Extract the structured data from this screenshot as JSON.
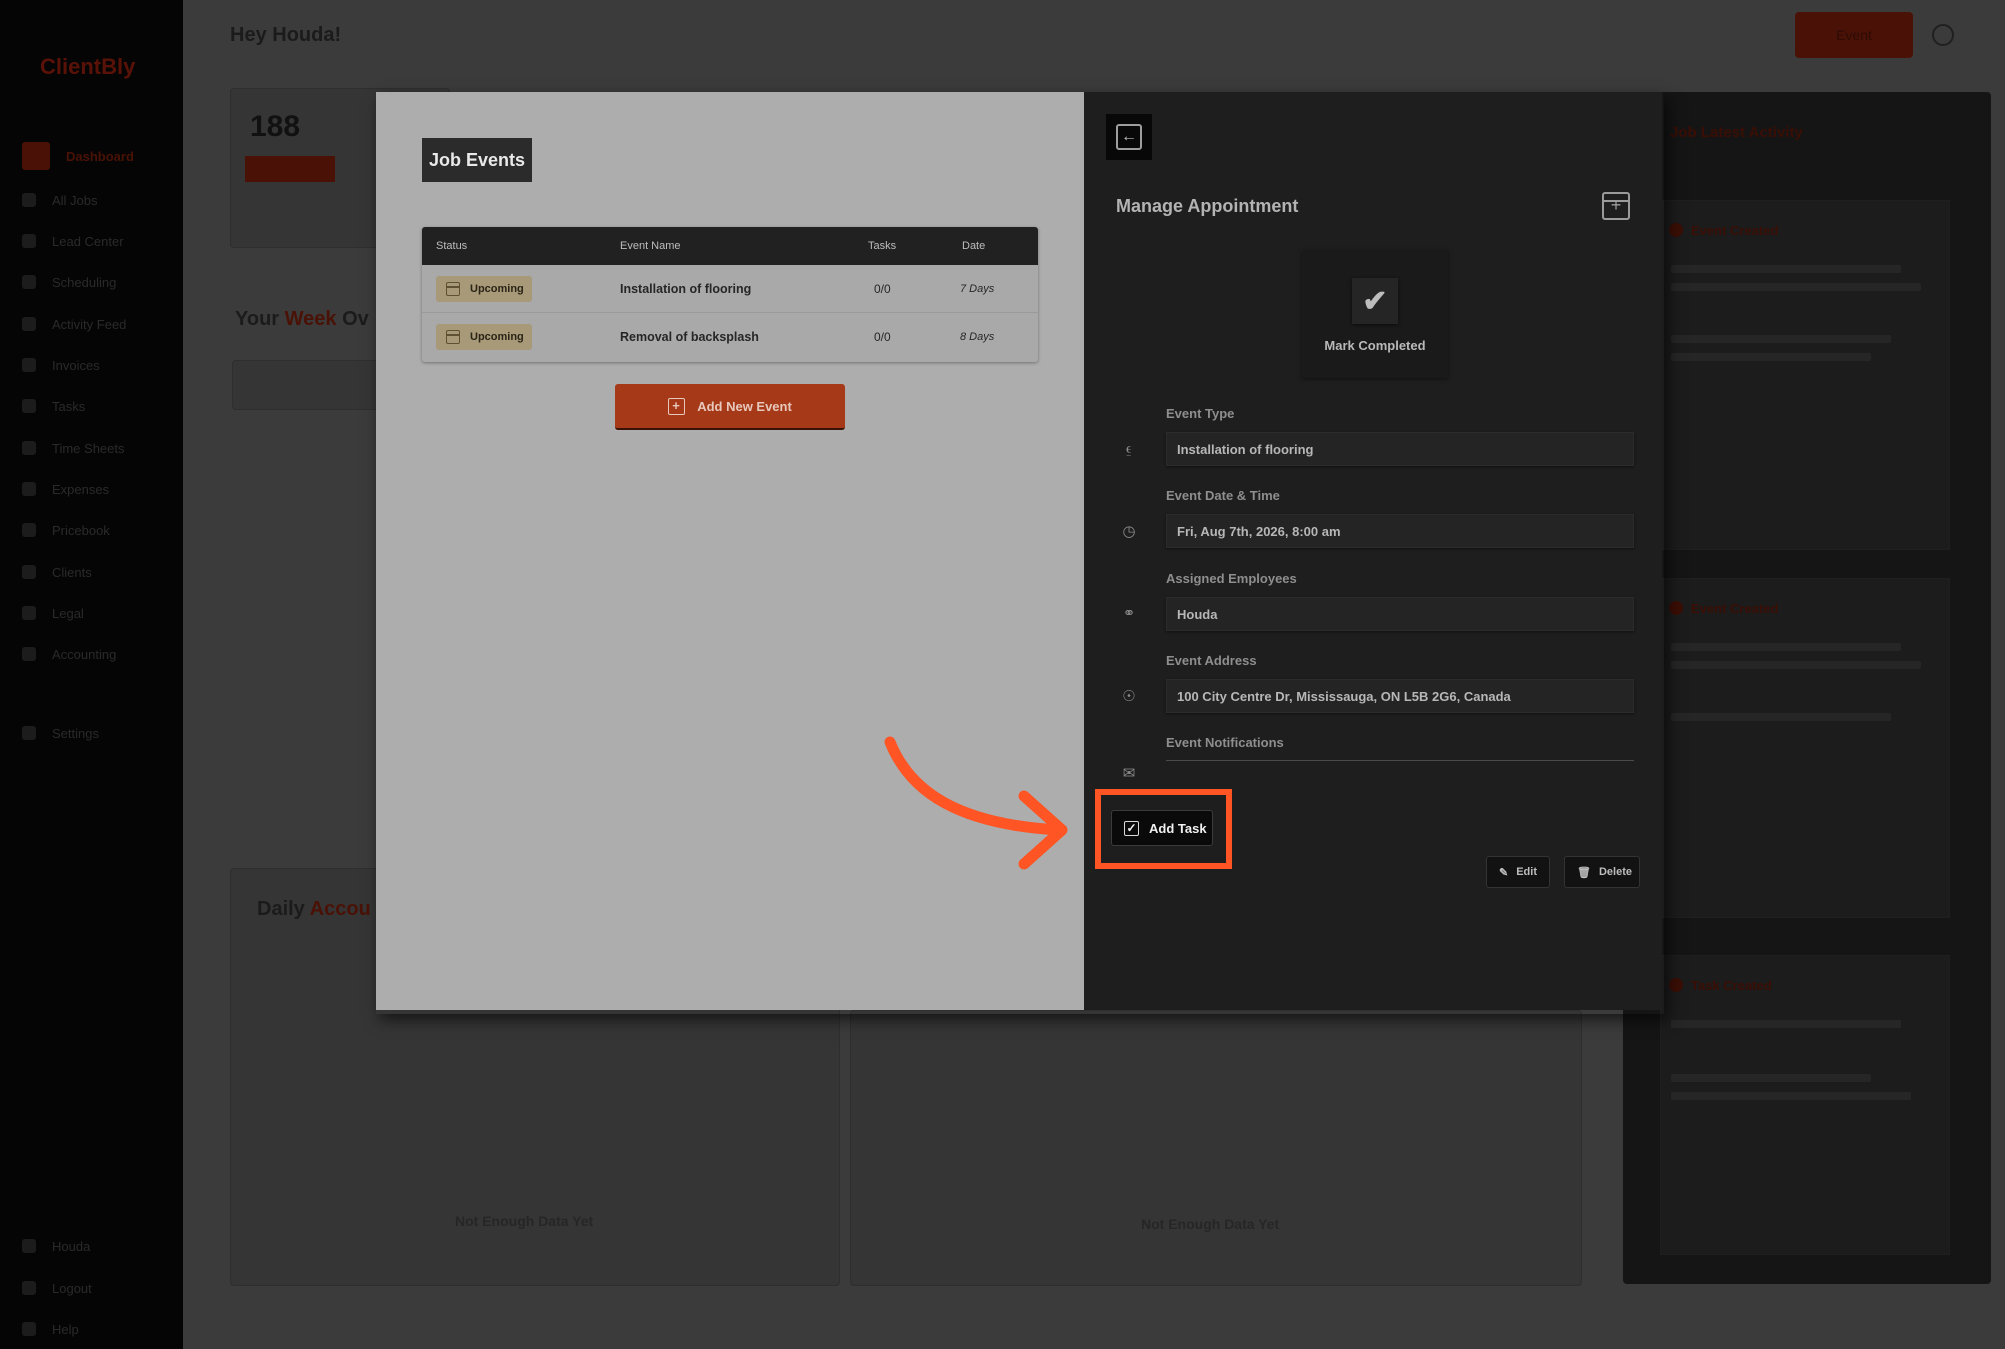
{
  "background": {
    "brand": "ClientBly",
    "greeting": "Hey Houda!",
    "top_button": "Event",
    "nav": [
      "Dashboard",
      "All Jobs",
      "Lead Center",
      "Scheduling",
      "Activity Feed",
      "Invoices",
      "Tasks",
      "Time Sheets",
      "Expenses",
      "Pricebook",
      "Clients",
      "Legal",
      "Accounting",
      "Settings",
      "Houda",
      "Logout",
      "Help"
    ],
    "stat_value": "188",
    "stat_badge": "Active Jobs",
    "week_heading_a": "Your ",
    "week_heading_b": "Week",
    "week_heading_c": " Ov",
    "daily_heading_a": "Daily ",
    "daily_heading_b": "Accou",
    "not_enough_1": "Not Enough Data Yet",
    "not_enough_2": "Not Enough Data Yet",
    "feed_title": "Job Latest Activity",
    "feed_cards": [
      "Event Created",
      "Event Created",
      "Task Created"
    ]
  },
  "job_events": {
    "title": "Job Events",
    "columns": {
      "status": "Status",
      "name": "Event Name",
      "tasks": "Tasks",
      "date": "Date"
    },
    "rows": [
      {
        "status": "Upcoming",
        "name": "Installation of flooring",
        "tasks": "0/0",
        "date": "7 Days"
      },
      {
        "status": "Upcoming",
        "name": "Removal of backsplash",
        "tasks": "0/0",
        "date": "8 Days"
      }
    ],
    "add_button": "Add New Event"
  },
  "manage": {
    "title": "Manage Appointment",
    "mark_completed": "Mark Completed",
    "event_type_label": "Event Type",
    "event_type_value": "Installation of flooring",
    "event_datetime_label": "Event Date & Time",
    "event_datetime_value": "Fri, Aug 7th, 2026, 8:00 am",
    "employees_label": "Assigned Employees",
    "employees_value": "Houda",
    "address_label": "Event Address",
    "address_value": "100 City Centre Dr, Mississauga, ON L5B 2G6, Canada",
    "notifications_label": "Event Notifications",
    "add_task": "Add Task",
    "edit": "Edit",
    "delete": "Delete"
  },
  "colors": {
    "accent": "#ff5423",
    "brand_red": "#a63917",
    "panel_dark": "#1e1e1e",
    "panel_light": "#adadad"
  }
}
